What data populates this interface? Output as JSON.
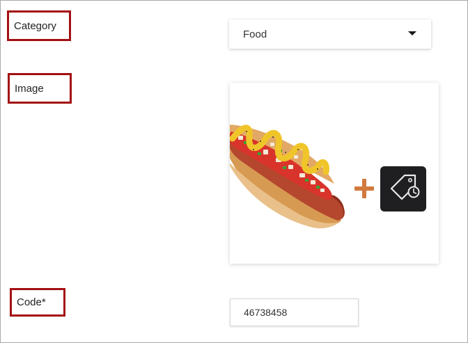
{
  "form": {
    "category": {
      "label": "Category",
      "value": "Food"
    },
    "image": {
      "label": "Image"
    },
    "code": {
      "label": "Code*",
      "value": "46738458"
    }
  },
  "icons": {
    "dropdown": "caret-down-icon",
    "plus": "plus-icon",
    "tag": "price-tag-clock-icon",
    "product_image": "hot-dog-image"
  },
  "colors": {
    "label_border": "#a30f12",
    "plus": "#d27a3e",
    "tag_tile": "#1f1f22"
  }
}
